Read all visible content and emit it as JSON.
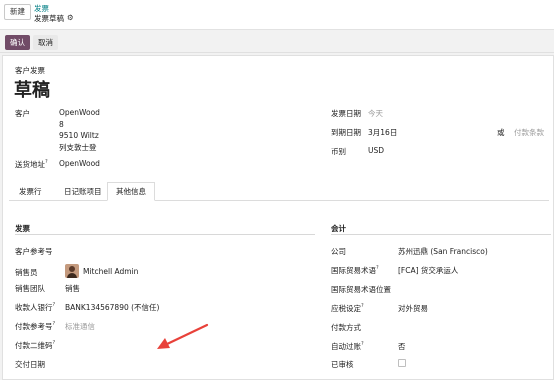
{
  "topbar": {
    "new_label": "新建",
    "breadcrumb_parent": "发票",
    "breadcrumb_current": "发票草稿",
    "gear_icon": "gear-icon"
  },
  "actions": {
    "confirm_label": "确认",
    "cancel_label": "取消"
  },
  "document": {
    "type_label": "客户发票",
    "status_title": "草稿"
  },
  "header_left": {
    "customer_label": "客户",
    "customer_name": "OpenWood",
    "address_line1": "8",
    "address_line2": "9510 Wiltz",
    "address_line3": "列支敦士登",
    "delivery_label": "送货地址",
    "delivery_value": "OpenWood"
  },
  "header_right": {
    "invoice_date_label": "发票日期",
    "invoice_date_placeholder": "今天",
    "due_date_label": "到期日期",
    "due_date_value": "3月16日",
    "or_label": "或",
    "payment_terms_placeholder": "付款条款",
    "currency_label": "币别",
    "currency_value": "USD"
  },
  "tabs": [
    {
      "label": "发票行"
    },
    {
      "label": "日记账项目"
    },
    {
      "label": "其他信息"
    }
  ],
  "invoice_section": {
    "title": "发票",
    "customer_ref_label": "客户参考号",
    "salesperson_label": "销售员",
    "salesperson_value": "Mitchell Admin",
    "sales_team_label": "销售团队",
    "sales_team_value": "销售",
    "bank_label": "收款人银行",
    "bank_value": "BANK134567890 (不信任)",
    "payment_ref_label": "付款参考号",
    "payment_ref_placeholder": "标准通信",
    "qr_label": "付款二维码",
    "delivery_date_label": "交付日期"
  },
  "accounting_section": {
    "title": "会计",
    "company_label": "公司",
    "company_value": "苏州迅鼎 (San Francisco)",
    "incoterm_label": "国际贸易术语",
    "incoterm_value": "[FCA] 货交承运人",
    "incoterm_location_label": "国际贸易术语位置",
    "fiscal_position_label": "应税设定",
    "fiscal_position_value": "对外贸易",
    "payment_method_label": "付款方式",
    "auto_post_label": "自动过账",
    "auto_post_value": "否",
    "checked_label": "已审核"
  },
  "colors": {
    "primary": "#714b67",
    "link": "#017e84",
    "annotation_arrow": "#e8413a"
  }
}
